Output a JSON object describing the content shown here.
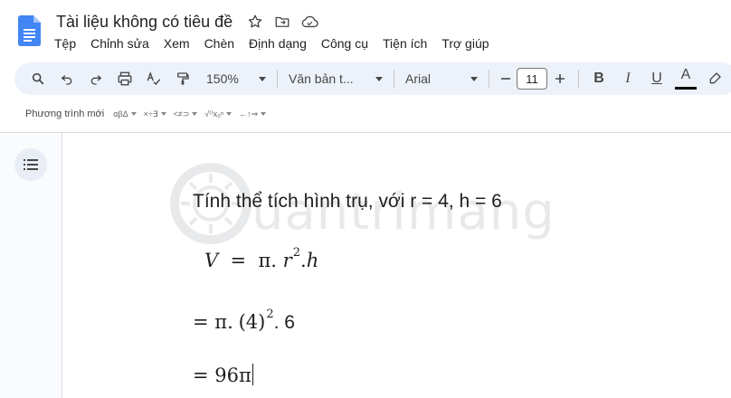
{
  "app": {
    "title": "Tài liệu không có tiêu đề",
    "icons": [
      "docs-logo-icon",
      "star-icon",
      "move-folder-icon",
      "cloud-status-icon"
    ]
  },
  "menu": [
    "Tệp",
    "Chỉnh sửa",
    "Xem",
    "Chèn",
    "Định dạng",
    "Công cụ",
    "Tiện ích",
    "Trợ giúp"
  ],
  "toolbar": {
    "zoom": "150%",
    "style": "Văn bản t...",
    "font": "Arial",
    "font_size": "11",
    "bold": "B",
    "italic": "I",
    "underline": "U",
    "text_color_letter": "A",
    "text_color": "#000000"
  },
  "equation_bar": {
    "label": "Phương trình mới",
    "groups": [
      "αβΔ",
      "×÷∃",
      "<≠⊃",
      "√⁽⁾x₀ⁿ",
      "←↑⇒"
    ]
  },
  "document": {
    "line1": "Tính thể tích hình trụ, với r = 4, h = 6",
    "line2": {
      "v": "V",
      "eq": "=",
      "pi": "π.",
      "r": "r",
      "exp": "2",
      "dot_h": ".",
      "h": "h"
    },
    "line3": {
      "prefix": "= π.",
      "base": "(4)",
      "exp": "2",
      "suffix": ". 6"
    },
    "line4": "= 96π"
  },
  "watermark": "uantrimang"
}
